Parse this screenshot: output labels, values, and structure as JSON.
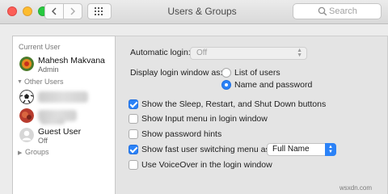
{
  "window": {
    "title": "Users & Groups",
    "search_placeholder": "Search"
  },
  "sidebar": {
    "current_user_label": "Current User",
    "current_user": {
      "name": "Mahesh Makvana",
      "role": "Admin"
    },
    "other_users_label": "Other Users",
    "guest_user": {
      "name": "Guest User",
      "status": "Off"
    },
    "groups_label": "Groups"
  },
  "settings": {
    "automatic_login_label": "Automatic login:",
    "automatic_login_value": "Off",
    "display_login_window_label": "Display login window as:",
    "display_options": [
      {
        "label": "List of users",
        "selected": false
      },
      {
        "label": "Name and password",
        "selected": true
      }
    ],
    "checkboxes": [
      {
        "label": "Show the Sleep, Restart, and Shut Down buttons",
        "checked": true
      },
      {
        "label": "Show Input menu in login window",
        "checked": false
      },
      {
        "label": "Show password hints",
        "checked": false
      },
      {
        "label": "Show fast user switching menu as",
        "checked": true
      },
      {
        "label": "Use VoiceOver in the login window",
        "checked": false
      }
    ],
    "fast_user_switching_value": "Full Name"
  },
  "watermark": "wsxdn.com",
  "colors": {
    "accent": "#2b82f7",
    "close": "#fc5f57",
    "minimize": "#fdbc2e",
    "maximize": "#28c940"
  }
}
